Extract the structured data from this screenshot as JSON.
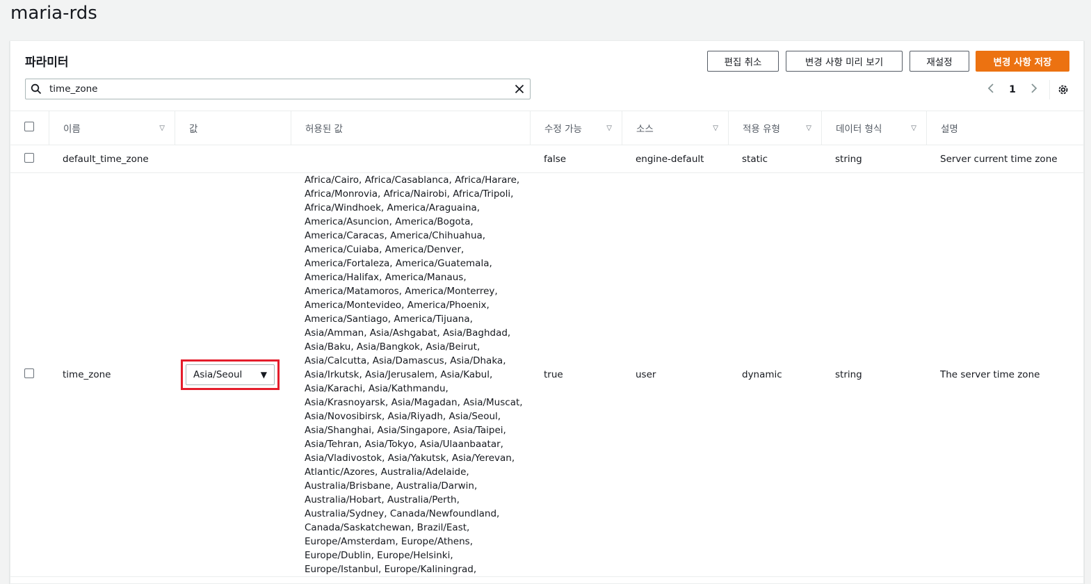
{
  "page": {
    "title": "maria-rds"
  },
  "panel": {
    "title": "파라미터",
    "buttons": {
      "cancel_edit": "편집 취소",
      "preview_changes": "변경 사항 미리 보기",
      "reset": "재설정",
      "save_changes": "변경 사항 저장"
    },
    "search": {
      "value": "time_zone",
      "placeholder": ""
    },
    "pager": {
      "current_page": "1"
    }
  },
  "columns": {
    "name": "이름",
    "value": "값",
    "allowed": "허용된 값",
    "modifiable": "수정 가능",
    "source": "소스",
    "apply_type": "적용 유형",
    "data_type": "데이터 형식",
    "description": "설명"
  },
  "rows": [
    {
      "name": "default_time_zone",
      "value": "",
      "allowed": "",
      "modifiable": "false",
      "source": "engine-default",
      "apply_type": "static",
      "data_type": "string",
      "description": "Server current time zone"
    },
    {
      "name": "time_zone",
      "value": "Asia/Seoul",
      "allowed_lines": [
        "Africa/Cairo, Africa/Casablanca, Africa/Harare,",
        "Africa/Monrovia, Africa/Nairobi, Africa/Tripoli,",
        "Africa/Windhoek, America/Araguaina,",
        "America/Asuncion, America/Bogota,",
        "America/Caracas, America/Chihuahua,",
        "America/Cuiaba, America/Denver,",
        "America/Fortaleza, America/Guatemala,",
        "America/Halifax, America/Manaus,",
        "America/Matamoros, America/Monterrey,",
        "America/Montevideo, America/Phoenix,",
        "America/Santiago, America/Tijuana,",
        "Asia/Amman, Asia/Ashgabat, Asia/Baghdad,",
        "Asia/Baku, Asia/Bangkok, Asia/Beirut,",
        "Asia/Calcutta, Asia/Damascus, Asia/Dhaka,",
        "Asia/Irkutsk, Asia/Jerusalem, Asia/Kabul,",
        "Asia/Karachi, Asia/Kathmandu,",
        "Asia/Krasnoyarsk, Asia/Magadan, Asia/Muscat,",
        "Asia/Novosibirsk, Asia/Riyadh, Asia/Seoul,",
        "Asia/Shanghai, Asia/Singapore, Asia/Taipei,",
        "Asia/Tehran, Asia/Tokyo, Asia/Ulaanbaatar,",
        "Asia/Vladivostok, Asia/Yakutsk, Asia/Yerevan,",
        "Atlantic/Azores, Australia/Adelaide,",
        "Australia/Brisbane, Australia/Darwin,",
        "Australia/Hobart, Australia/Perth,",
        "Australia/Sydney, Canada/Newfoundland,",
        "Canada/Saskatchewan, Brazil/East,",
        "Europe/Amsterdam, Europe/Athens,",
        "Europe/Dublin, Europe/Helsinki,",
        "Europe/Istanbul, Europe/Kaliningrad,"
      ],
      "modifiable": "true",
      "source": "user",
      "apply_type": "dynamic",
      "data_type": "string",
      "description": "The server time zone"
    }
  ],
  "colors": {
    "primary": "#ec7211",
    "highlight": "#e41d2b"
  }
}
